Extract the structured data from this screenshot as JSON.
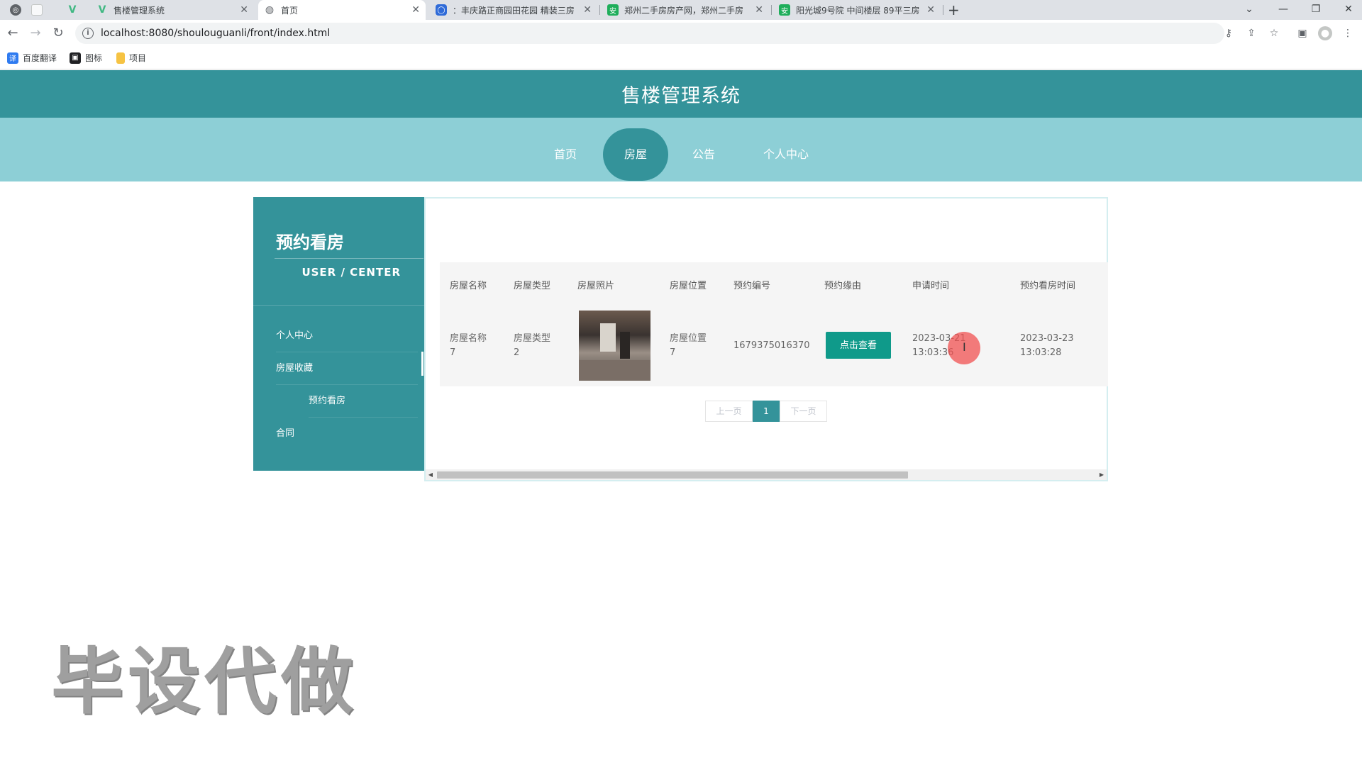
{
  "browser": {
    "tabs": [
      {
        "title": "售楼管理系统",
        "favicon": "vue-icon",
        "active": false
      },
      {
        "title": "首页",
        "favicon": "globe-icon",
        "active": true
      },
      {
        "title": "：丰庆路正商园田花园 精装三房",
        "favicon": "circle-app-icon",
        "active": false
      },
      {
        "title": "郑州二手房房产网，郑州二手房",
        "favicon": "anjuke-icon",
        "active": false
      },
      {
        "title": "阳光城9号院 中间楼层 89平三房",
        "favicon": "anjuke-icon",
        "active": false
      }
    ],
    "url": "localhost:8080/shoulouguanli/front/index.html",
    "bookmarks": [
      {
        "label": "百度翻译",
        "icon": "translate-icon"
      },
      {
        "label": "图标",
        "icon": "image-icon"
      },
      {
        "label": "项目",
        "icon": "folder-icon"
      }
    ]
  },
  "site": {
    "title": "售楼管理系统",
    "nav": [
      "首页",
      "房屋",
      "公告",
      "个人中心"
    ],
    "active_nav": "房屋",
    "accent": "#34939a",
    "nav_bg": "#8dcfd6"
  },
  "sidebar": {
    "title": "预约看房",
    "subtitle": "USER / CENTER",
    "items": [
      {
        "label": "个人中心"
      },
      {
        "label": "房屋收藏"
      },
      {
        "label": "预约看房"
      },
      {
        "label": "合同"
      }
    ]
  },
  "table": {
    "headers": [
      "房屋名称",
      "房屋类型",
      "房屋照片",
      "房屋位置",
      "预约编号",
      "预约缘由",
      "申请时间",
      "预约看房时间"
    ],
    "rows": [
      {
        "name_line1": "房屋名称",
        "name_line2": "7",
        "type_line1": "房屋类型",
        "type_line2": "2",
        "location_line1": "房屋位置",
        "location_line2": "7",
        "booking_no": "1679375016370",
        "reason_button": "点击查看",
        "apply_date": "2023-03-21",
        "apply_time": "13:03:36",
        "visit_date": "2023-03-23",
        "visit_time": "13:03:28"
      }
    ]
  },
  "pagination": {
    "prev": "上一页",
    "current": "1",
    "next": "下一页"
  },
  "watermark": "毕设代做"
}
